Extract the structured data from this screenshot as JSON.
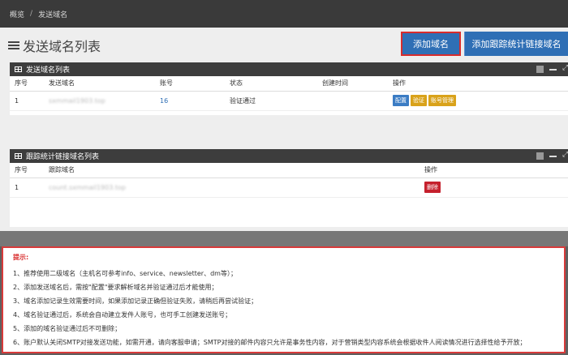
{
  "breadcrumb": {
    "home": "概览",
    "separator": "/",
    "current": "发送域名"
  },
  "page_title": "发送域名列表",
  "buttons": {
    "add_domain": "添加域名",
    "add_track_domain": "添加跟踪统计链接域名"
  },
  "sender_panel": {
    "title": "发送域名列表",
    "columns": [
      "序号",
      "发送域名",
      "账号",
      "状态",
      "创建时间",
      "操作"
    ],
    "rows": [
      {
        "index": "1",
        "domain": "sxmmail1903.top",
        "account": "16",
        "status": "验证通过",
        "created": "",
        "actions": [
          "配置",
          "验证",
          "账号管理"
        ]
      }
    ]
  },
  "track_panel": {
    "title": "跟踪统计链接域名列表",
    "columns": [
      "序号",
      "跟踪域名",
      "操作"
    ],
    "rows": [
      {
        "index": "1",
        "domain": "count.sxmmail1903.top",
        "action": "删除"
      }
    ]
  },
  "tips": {
    "title": "提示:",
    "items": [
      "1、推荐使用二级域名（主机名可参考info、service、newsletter、dm等）；",
      "2、添加发送域名后，需按\"配置\"要求解析域名并验证通过后才能使用；",
      "3、域名添加记录生效需要时间，如果添加记录正确但验证失败，请稍后再尝试验证；",
      "4、域名验证通过后，系统会自动建立发件人账号，也可手工创建发送账号；",
      "5、添加的域名验证通过后不可删除；",
      "6、账户默认关闭SMTP对接发送功能，如需开通，请向客服申请；SMTP对接的邮件内容只允许是事务性内容，对于营销类型内容系统会根据收件人阅读情况进行选择性给予开放；"
    ]
  },
  "colors": {
    "primary": "#2f6fb5",
    "highlight_border": "#d82c2c",
    "panel_header": "#3d3d3d"
  },
  "icons": {
    "title": "list-icon",
    "panel": "table-icon"
  }
}
